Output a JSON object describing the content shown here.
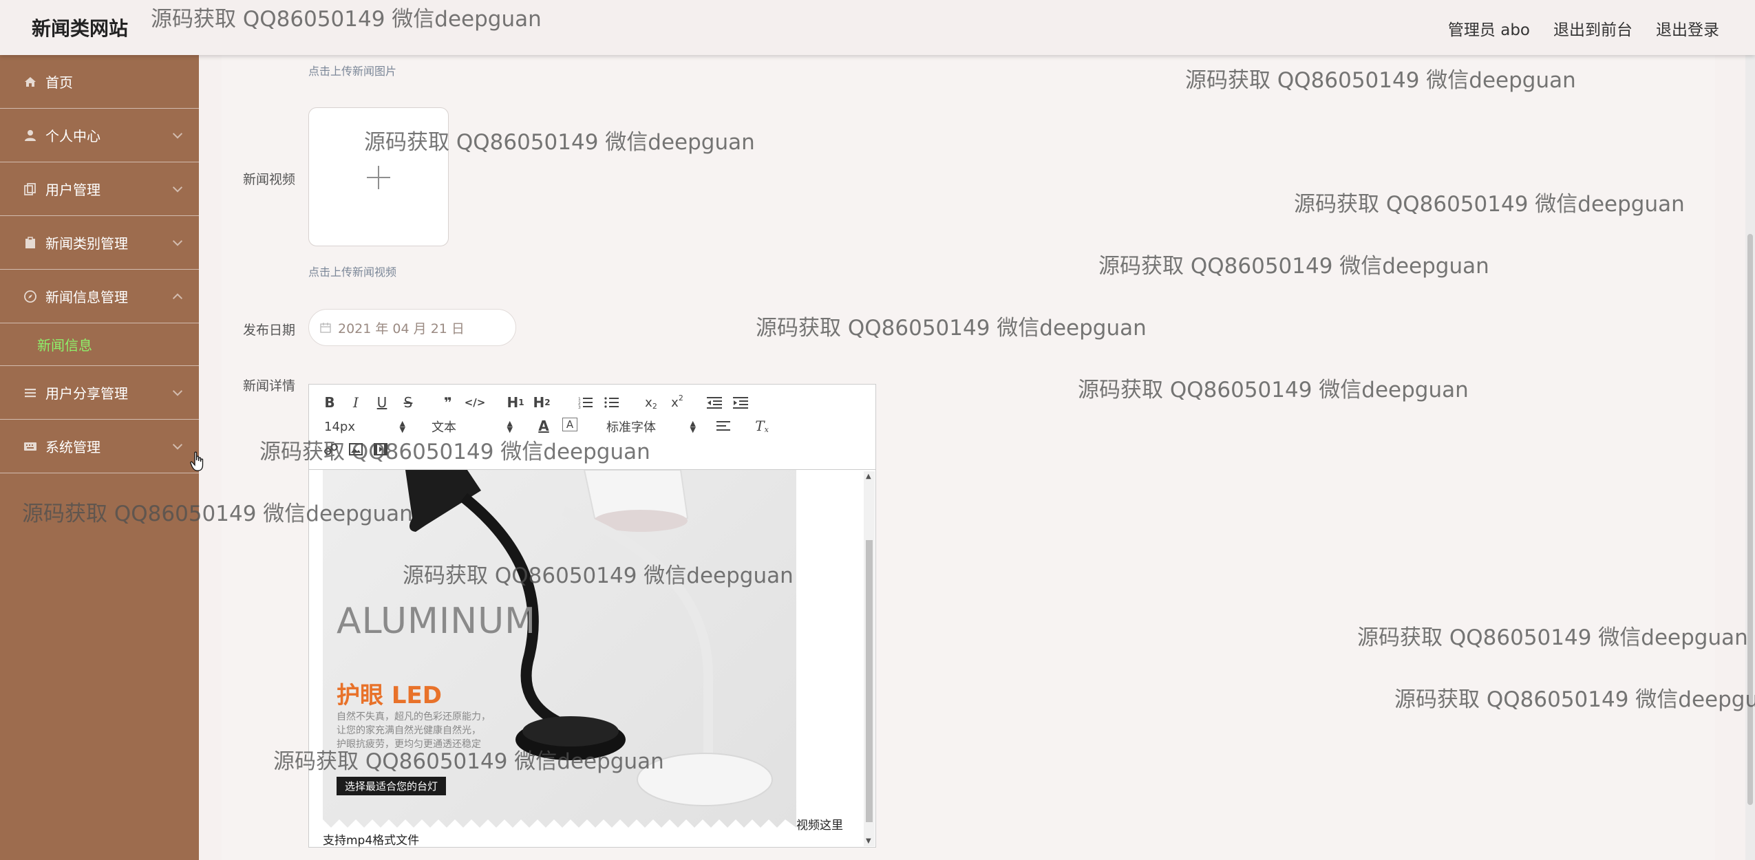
{
  "header": {
    "brand": "新闻类网站",
    "admin_label": "管理员 abo",
    "to_front_label": "退出到前台",
    "logout_label": "退出登录"
  },
  "sidebar": {
    "items": [
      {
        "label": "首页",
        "icon": "home-icon"
      },
      {
        "label": "个人中心",
        "icon": "user-icon"
      },
      {
        "label": "用户管理",
        "icon": "copy-icon"
      },
      {
        "label": "新闻类别管理",
        "icon": "clipboard-icon"
      },
      {
        "label": "新闻信息管理",
        "icon": "compass-icon",
        "expanded": true
      },
      {
        "label": "用户分享管理",
        "icon": "list-icon"
      },
      {
        "label": "系统管理",
        "icon": "keyboard-icon"
      }
    ],
    "submenu": {
      "label": "新闻信息"
    }
  },
  "form": {
    "image_upload_hint": "点击上传新闻图片",
    "video_label": "新闻视频",
    "video_upload_hint": "点击上传新闻视频",
    "date_label": "发布日期",
    "date_value": "2021 年 04 月 21 日",
    "detail_label": "新闻详情"
  },
  "editor": {
    "font_size": "14px",
    "header_select": "文本",
    "font_family": "标准字体",
    "video_placeholder": "视频这里",
    "content_text": "支持mp4格式文件",
    "image": {
      "brand_text": "ALUMINUM",
      "headline": "护眼 LED",
      "lines": [
        "自然不失真，超凡的色彩还原能力，",
        "让您的家充满自然光健康自然光，",
        "护眼抗疲劳，更均匀更通透还稳定"
      ],
      "button": "选择最适合您的台灯"
    }
  },
  "watermark": "源码获取 QQ86050149 微信deepguan",
  "colors": {
    "sidebar": "#9d6c4e",
    "submenu_active": "#8ef16b",
    "header_bg": "#f4efee",
    "headline_orange": "#e8722a"
  }
}
